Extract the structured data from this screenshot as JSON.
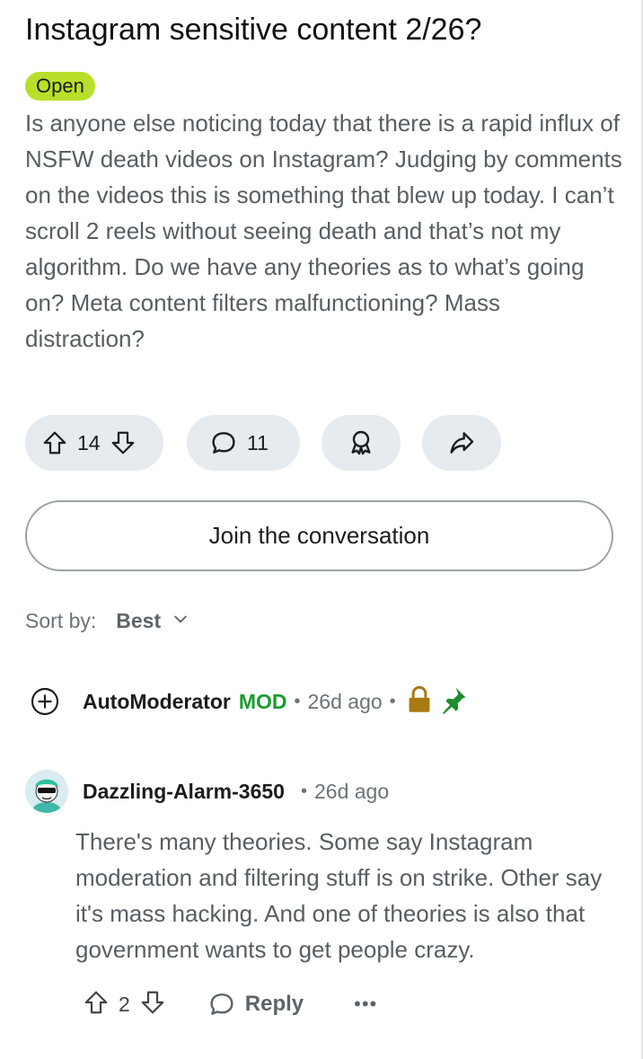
{
  "post": {
    "title": "Instagram sensitive content 2/26?",
    "flair": "Open",
    "body": "Is anyone else noticing today that there is a rapid influx of NSFW death videos on Instagram? Judging by comments on the videos this is something that blew up today. I can’t scroll 2 reels without seeing death and that’s not my algorithm. Do we have any theories as to what’s going on? Meta content filters malfunctioning? Mass distraction?",
    "votes": "14",
    "comments": "11"
  },
  "join_label": "Join the conversation",
  "sort": {
    "label": "Sort by:",
    "value": "Best"
  },
  "mod_comment": {
    "author": "AutoModerator",
    "tag": "MOD",
    "age": "26d ago"
  },
  "comment": {
    "author": "Dazzling-Alarm-3650",
    "age": "26d ago",
    "text": "There's many theories. Some say Instagram moderation and filtering stuff is on strike. Other say it's mass hacking. And one of theories is also that government wants to get people crazy.",
    "votes": "2",
    "reply_label": "Reply",
    "more_label": "•••"
  },
  "icons": {
    "upvote": "upvote-arrow-icon",
    "downvote": "downvote-arrow-icon",
    "comment": "comment-bubble-icon",
    "award": "award-ribbon-icon",
    "share": "share-arrow-icon",
    "expand": "plus-circle-icon",
    "lock": "lock-icon",
    "pin": "pin-icon",
    "chevron": "chevron-down-icon"
  },
  "colors": {
    "flair_bg": "#b8e02a",
    "mod_green": "#1a9c2e",
    "lock_gold": "#a87a10",
    "pill_bg": "#e5ebee"
  }
}
